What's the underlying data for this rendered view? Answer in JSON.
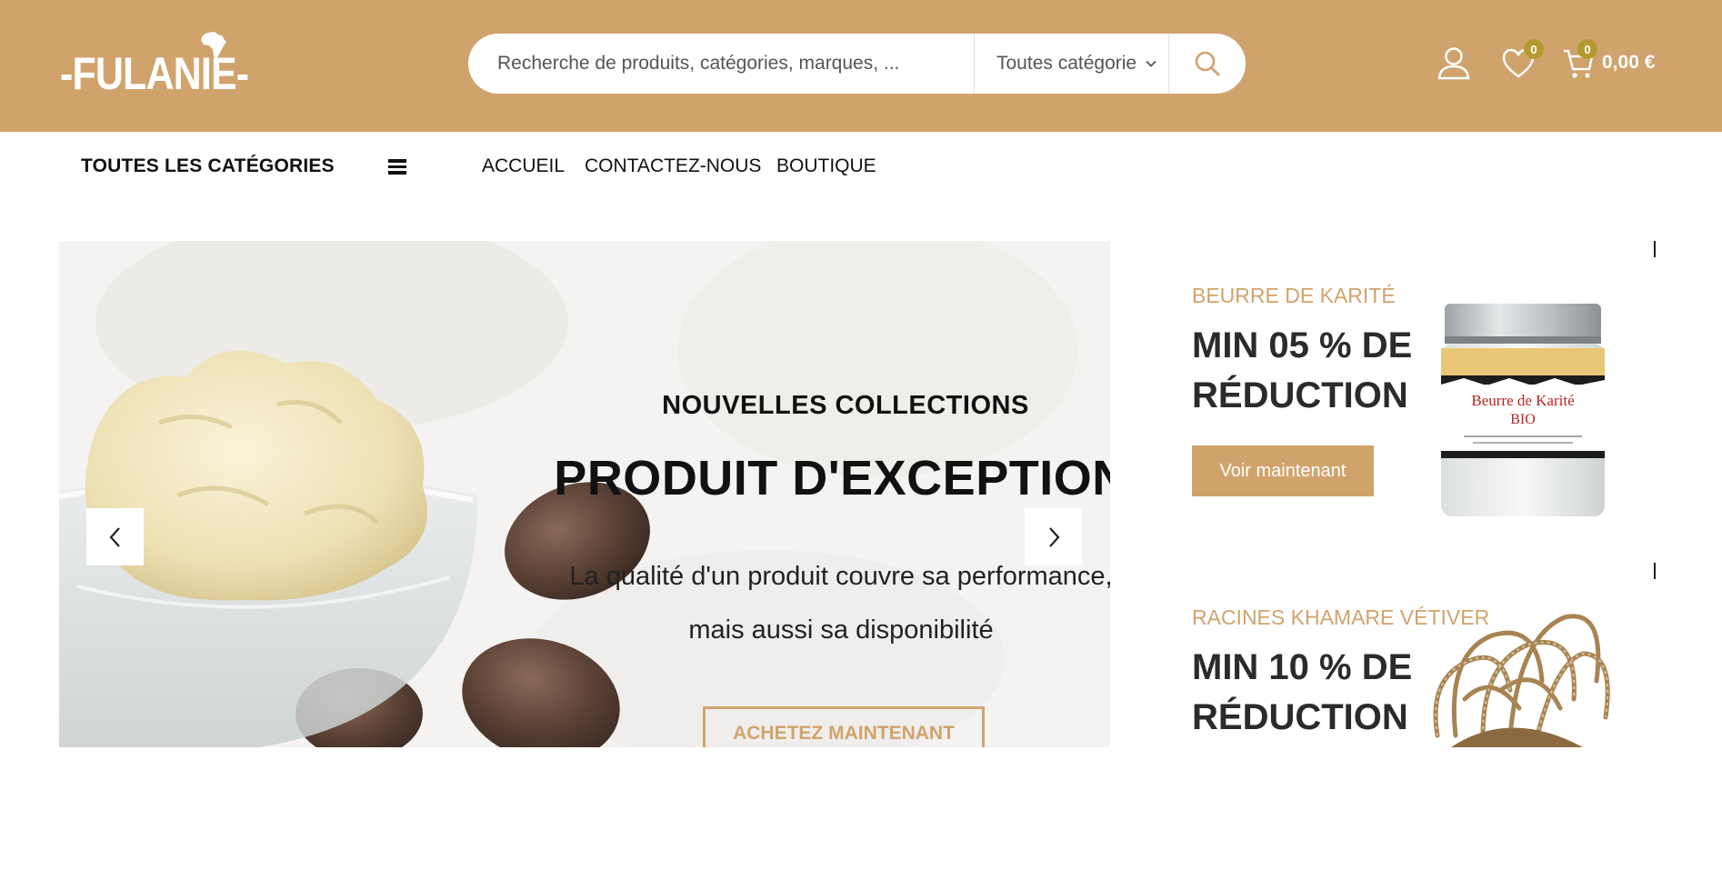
{
  "header": {
    "logo_text": "-FULANIE-",
    "search_placeholder": "Recherche de produits, catégories, marques, ...",
    "category_select": "Toutes catégorie",
    "wishlist_count": "0",
    "cart_count": "0",
    "cart_total": "0,00 €",
    "colors": {
      "brand": "#d1a36c",
      "badge": "#b39a2f"
    },
    "icons": [
      "africa-map-icon",
      "chevron-down-icon",
      "search-icon",
      "user-icon",
      "heart-icon",
      "cart-icon"
    ]
  },
  "nav": {
    "all_categories": "TOUTES LES CATÉGORIES",
    "links": [
      "ACCUEIL",
      "CONTACTEZ-NOUS",
      "BOUTIQUE"
    ]
  },
  "hero": {
    "subtitle": "NOUVELLES COLLECTIONS",
    "title": "PRODUIT D'EXCEPTION",
    "desc_line1": "La qualité d'un produit couvre sa performance,",
    "desc_line2": "mais aussi sa disponibilité",
    "button": "ACHETEZ MAINTENANT"
  },
  "banners": [
    {
      "tag": "BEURRE DE KARITÉ",
      "title_line1": "MIN 05 % DE",
      "title_line2": "RÉDUCTION",
      "button": "Voir maintenant",
      "jar_label_line1": "Beurre de Karité",
      "jar_label_line2": "BIO"
    },
    {
      "tag": "RACINES KHAMARE VÉTIVER",
      "title_line1": "MIN 10 % DE",
      "title_line2": "RÉDUCTION"
    }
  ]
}
